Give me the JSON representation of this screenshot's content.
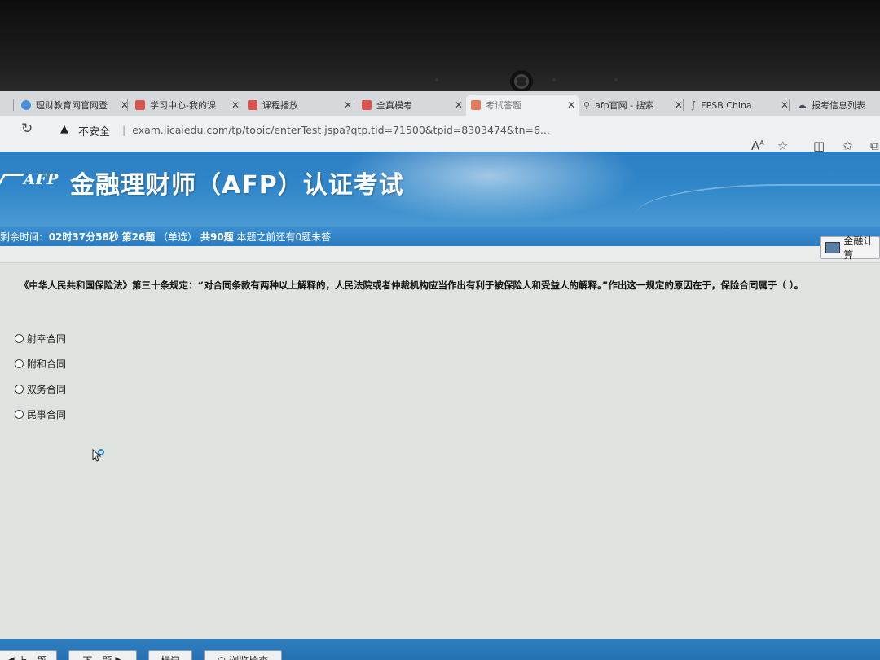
{
  "browser": {
    "tabs": [
      {
        "label": "理财教育网官网登",
        "active": false
      },
      {
        "label": "学习中心-我的课",
        "active": false
      },
      {
        "label": "课程播放",
        "active": false
      },
      {
        "label": "全真模考",
        "active": false
      },
      {
        "label": "考试答题",
        "active": true
      },
      {
        "label": "afp官网 - 搜索",
        "active": false
      },
      {
        "label": "FPSB China",
        "active": false
      },
      {
        "label": "报考信息列表",
        "active": false
      }
    ],
    "security_label": "不安全",
    "url": "exam.licaiedu.com/tp/topic/enterTest.jspa?qtp.tid=71500&tpid=8303474&tn=6..."
  },
  "header": {
    "logo": "AFP",
    "title": "金融理财师（AFP）认证考试"
  },
  "status": {
    "remaining_label": "剩余时间:",
    "remaining_time": "02时37分58秒",
    "question_no": "第26题",
    "question_type": "（单选）",
    "total": "共90题",
    "unanswered": "本题之前还有0题未答"
  },
  "calculator_label": "金融计算",
  "question": {
    "text": "《中华人民共和国保险法》第三十条规定：“对合同条款有两种以上解释的，人民法院或者仲裁机构应当作出有利于被保险人和受益人的解释。”作出这一规定的原因在于，保险合同属于（ ）。",
    "options": [
      "射幸合同",
      "附和合同",
      "双务合同",
      "民事合同"
    ]
  },
  "nav": {
    "prev": "上一题",
    "next": "下一题",
    "mark": "标记",
    "review": "浏览检查"
  },
  "colors": {
    "header_blue": "#2d7fc4",
    "status_blue": "#2a7cc3",
    "page_bg": "#dfe3df"
  }
}
